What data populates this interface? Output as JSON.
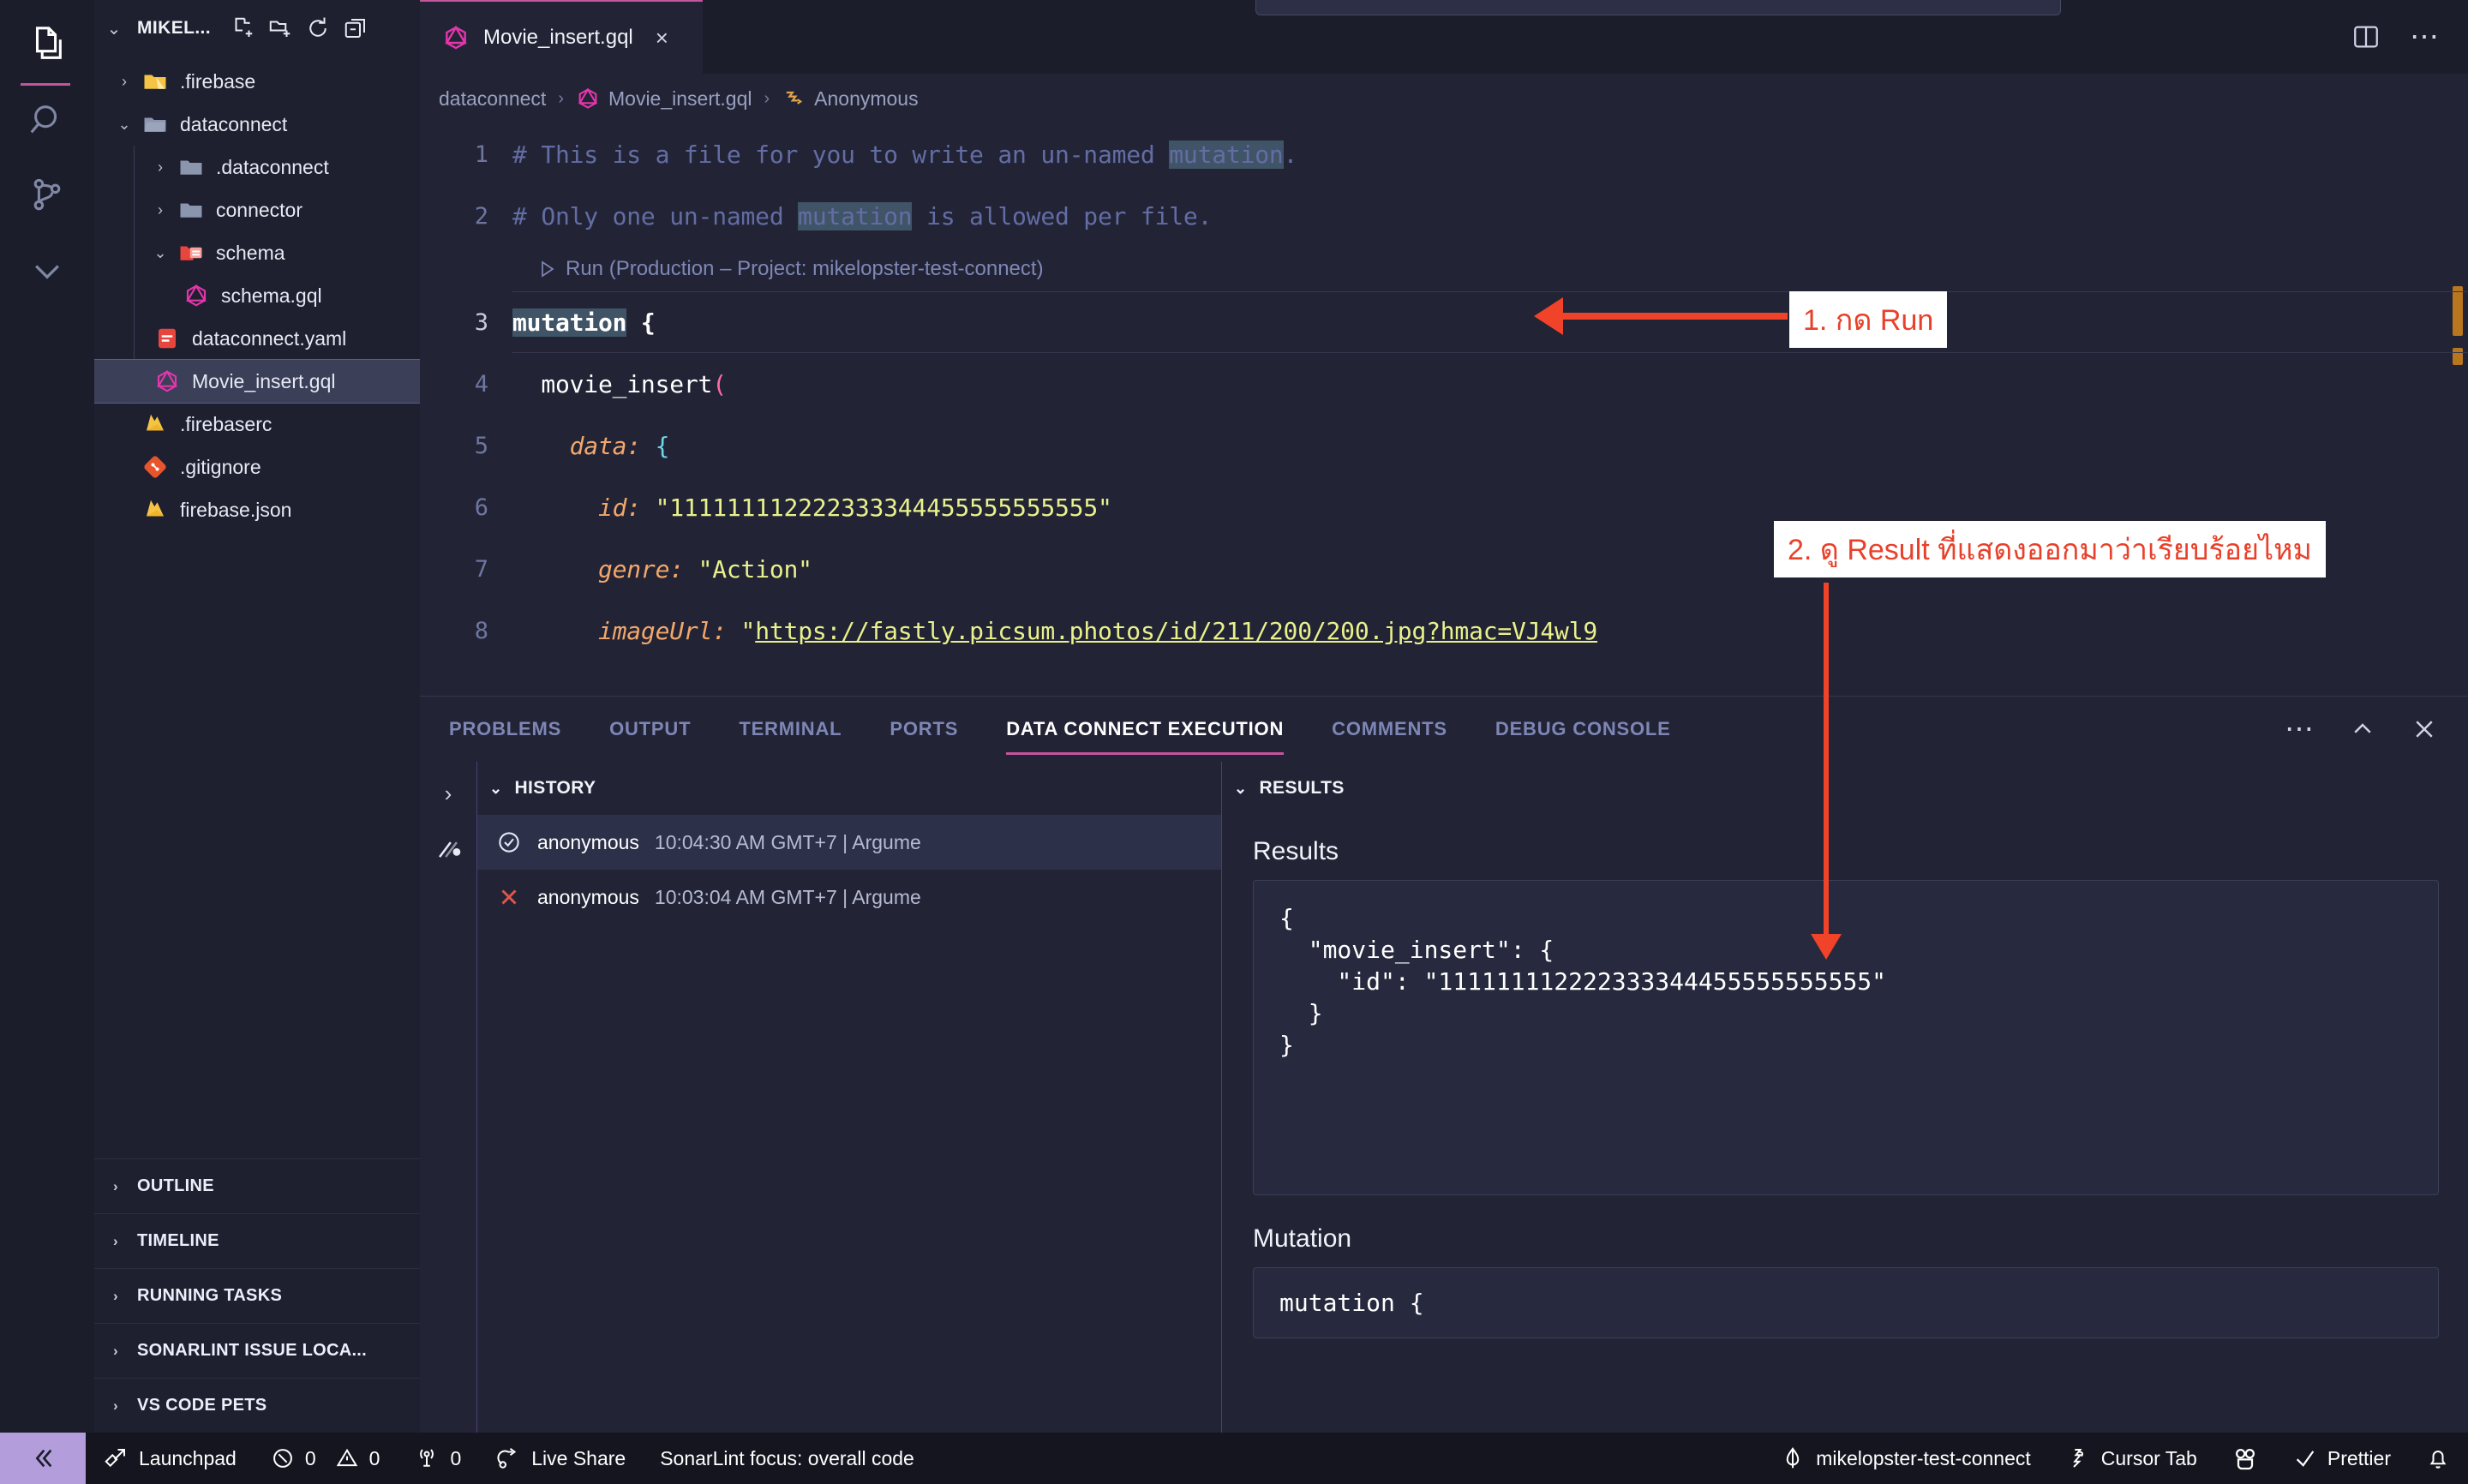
{
  "activity_bar": {
    "items": [
      {
        "name": "explorer",
        "icon": "files-icon",
        "active": true
      },
      {
        "name": "search",
        "icon": "search-icon",
        "active": false
      },
      {
        "name": "source-control",
        "icon": "source-control-icon",
        "active": false
      },
      {
        "name": "more-views",
        "icon": "chevron-down-icon",
        "active": false
      }
    ]
  },
  "sidebar": {
    "title": "MIKEL...",
    "actions": [
      "new-file-icon",
      "new-folder-icon",
      "refresh-icon",
      "collapse-all-icon"
    ],
    "tree": [
      {
        "label": ".firebase",
        "type": "folder",
        "expanded": false,
        "depth": 1,
        "icon": "folder-firebase-icon"
      },
      {
        "label": "dataconnect",
        "type": "folder",
        "expanded": true,
        "depth": 1,
        "icon": "folder-open-icon"
      },
      {
        "label": ".dataconnect",
        "type": "folder",
        "expanded": false,
        "depth": 2,
        "icon": "folder-icon"
      },
      {
        "label": "connector",
        "type": "folder",
        "expanded": false,
        "depth": 2,
        "icon": "folder-icon"
      },
      {
        "label": "schema",
        "type": "folder",
        "expanded": true,
        "depth": 2,
        "icon": "folder-schema-icon"
      },
      {
        "label": "schema.gql",
        "type": "file",
        "depth": 3,
        "icon": "graphql-icon"
      },
      {
        "label": "dataconnect.yaml",
        "type": "file",
        "depth": 2,
        "icon": "yaml-icon"
      },
      {
        "label": "Movie_insert.gql",
        "type": "file",
        "depth": 2,
        "icon": "graphql-icon",
        "selected": true
      },
      {
        "label": ".firebaserc",
        "type": "file",
        "depth": 1,
        "icon": "firebase-icon"
      },
      {
        "label": ".gitignore",
        "type": "file",
        "depth": 1,
        "icon": "git-icon"
      },
      {
        "label": "firebase.json",
        "type": "file",
        "depth": 1,
        "icon": "firebase-icon"
      }
    ],
    "sections": [
      {
        "label": "OUTLINE"
      },
      {
        "label": "TIMELINE"
      },
      {
        "label": "RUNNING TASKS"
      },
      {
        "label": "SONARLINT ISSUE LOCA..."
      },
      {
        "label": "VS CODE PETS"
      }
    ]
  },
  "editor": {
    "tab": {
      "label": "Movie_insert.gql",
      "icon": "graphql-icon",
      "close": "×"
    },
    "tab_actions": [
      "split-editor-icon",
      "more-actions-icon"
    ],
    "breadcrumbs": [
      {
        "label": "dataconnect",
        "icon": null
      },
      {
        "label": "Movie_insert.gql",
        "icon": "graphql-icon"
      },
      {
        "label": "Anonymous",
        "icon": "anonymous-symbol-icon"
      }
    ],
    "codelens": {
      "icon": "play-icon",
      "label": "Run (Production – Project: mikelopster-test-connect)"
    },
    "lines": [
      {
        "num": "1",
        "text": "# This is a file for you to write an un-named mutation."
      },
      {
        "num": "2",
        "text": "# Only one un-named mutation is allowed per file."
      },
      {
        "num": "3",
        "text": "mutation {"
      },
      {
        "num": "4",
        "text": "  movie_insert("
      },
      {
        "num": "5",
        "text": "    data: {"
      },
      {
        "num": "6",
        "text": "      id: \"111111112222333344455555555555\""
      },
      {
        "num": "7",
        "text": "      genre: \"Action\""
      },
      {
        "num": "8",
        "text": "      imageUrl: \"https://fastly.picsum.photos/id/211/200/200.jpg?hmac=VJ4wl9"
      }
    ]
  },
  "panel": {
    "tabs": [
      {
        "label": "PROBLEMS",
        "active": false
      },
      {
        "label": "OUTPUT",
        "active": false
      },
      {
        "label": "TERMINAL",
        "active": false
      },
      {
        "label": "PORTS",
        "active": false
      },
      {
        "label": "DATA CONNECT EXECUTION",
        "active": true
      },
      {
        "label": "COMMENTS",
        "active": false
      },
      {
        "label": "DEBUG CONSOLE",
        "active": false
      }
    ],
    "actions": [
      "more-actions-icon",
      "maximize-panel-icon",
      "close-panel-icon"
    ],
    "history": {
      "title": "HISTORY",
      "rows": [
        {
          "status": "success",
          "user": "anonymous",
          "meta": "10:04:30 AM GMT+7 | Argume",
          "selected": true
        },
        {
          "status": "error",
          "user": "anonymous",
          "meta": "10:03:04 AM GMT+7 | Argume",
          "selected": false
        }
      ]
    },
    "results": {
      "title": "RESULTS",
      "results_label": "Results",
      "results_json": "{\n  \"movie_insert\": {\n    \"id\": \"111111112222333344455555555555\"\n  }\n}",
      "mutation_label": "Mutation",
      "mutation_snippet": "mutation {"
    }
  },
  "status_bar": {
    "remote_icon": "remote-window-icon",
    "left": [
      {
        "icon": "launchpad-icon",
        "label": "Launchpad"
      },
      {
        "icon": "error-icon",
        "label": "0",
        "icon2": "warning-icon",
        "label2": "0"
      },
      {
        "icon": "radio-tower-icon",
        "label": "0"
      },
      {
        "icon": "live-share-icon",
        "label": "Live Share"
      },
      {
        "icon": null,
        "label": "SonarLint focus: overall code"
      }
    ],
    "right": [
      {
        "icon": "firebase-icon",
        "label": "mikelopster-test-connect"
      },
      {
        "icon": "cursor-icon",
        "label": "Cursor Tab"
      },
      {
        "icon": "pets-icon",
        "label": ""
      },
      {
        "icon": "check-icon",
        "label": "Prettier"
      },
      {
        "icon": "bell-icon",
        "label": ""
      }
    ]
  },
  "annotations": [
    {
      "id": "anno1",
      "text": "1. กด Run"
    },
    {
      "id": "anno2",
      "text": "2. ดู Result ที่แสดงออกมาว่าเรียบร้อยไหม"
    }
  ],
  "colors": {
    "accent": "#c3559c",
    "annotation_red": "#e8412b",
    "arrow_red": "#f0432a",
    "remote_purple": "#b39ddb",
    "graphql_pink": "#e535ab"
  }
}
